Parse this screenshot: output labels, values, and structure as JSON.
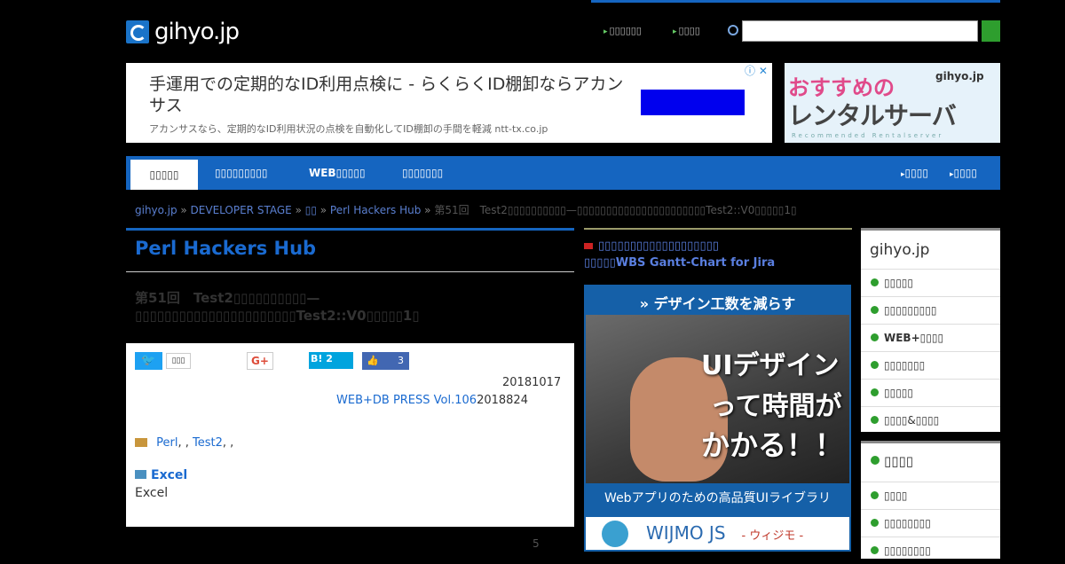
{
  "header": {
    "logo": "gihyo.jp",
    "links": [
      "▯▯▯▯▯▯",
      "▯▯▯▯"
    ],
    "search_placeholder": ""
  },
  "ad_banner": {
    "headline": "手運用での定期的なID利用点検に - らくらくID棚卸ならアカンサス",
    "subtext": "アカンサスなら、定期的なID利用状況の点検を自動化してID棚卸の手間を軽減 ntt-tx.co.jp",
    "choices_icon": "ⓘ ✕"
  },
  "ad_side": {
    "line1": "おすすめの",
    "line2": "レンタルサーバ",
    "tiny": "Recommended Rentalserver",
    "logo": "gihyo.jp"
  },
  "nav": {
    "items": [
      "▯▯▯▯▯",
      "▯▯▯▯▯▯▯▯▯",
      "WEB▯▯▯▯▯",
      "▯▯▯▯▯▯▯"
    ],
    "right": [
      "▯▯▯▯",
      "▯▯▯▯"
    ]
  },
  "breadcrumb": {
    "items": [
      "gihyo.jp",
      "DEVELOPER STAGE",
      "▯▯",
      "Perl Hackers Hub"
    ],
    "current": "第51回　Test2▯▯▯▯▯▯▯▯▯▯—▯▯▯▯▯▯▯▯▯▯▯▯▯▯▯▯▯▯▯▯▯▯Test2::V0▯▯▯▯▯1▯"
  },
  "main": {
    "section_title": "Perl Hackers Hub",
    "article_title": "第51回　Test2▯▯▯▯▯▯▯▯▯▯—▯▯▯▯▯▯▯▯▯▯▯▯▯▯▯▯▯▯▯▯▯▯Test2::V0▯▯▯▯▯1▯",
    "share": {
      "twitter": "🐦",
      "twitter_count": "▯▯▯",
      "gplus": "G+",
      "hatena": "B! 2",
      "fb": "👍",
      "fb_count": "3"
    },
    "date": "20181017",
    "magazine": "WEB+DB PRESS Vol.106",
    "magazine_date": "2018824",
    "tags_label": "",
    "tags": [
      "Perl",
      "Test2"
    ],
    "excel_heading": "Excel",
    "excel_text": "Excel",
    "page_number": "5"
  },
  "middle": {
    "link1": "▯▯▯▯▯▯▯▯▯▯▯▯▯▯▯▯▯▯▯",
    "link2": "▯▯▯▯▯WBS Gantt-Chart for Jira",
    "ad": {
      "top": "» デザイン工数を減らす",
      "t1": "UIデザイン",
      "t2": "って時間が",
      "t3": "かかる！！",
      "bottom": "Webアプリのための高品質UIライブラリ",
      "brand": "WIJMO JS",
      "brand_sub": "- ウィジモ -"
    }
  },
  "sidebar": {
    "logo": "gihyo.jp",
    "items": [
      "▯▯▯▯▯",
      "▯▯▯▯▯▯▯▯▯",
      "WEB+▯▯▯▯",
      "▯▯▯▯▯▯▯",
      "▯▯▯▯▯",
      "▯▯▯▯&▯▯▯▯"
    ],
    "section2_title": "▯▯▯▯",
    "section2_items": [
      "▯▯▯▯",
      "▯▯▯▯▯▯▯▯",
      "▯▯▯▯▯▯▯▯"
    ]
  },
  "colors": {
    "nav_blue": "#1565c0",
    "link_blue": "#1a6ad0",
    "green": "#2e9e2e"
  }
}
